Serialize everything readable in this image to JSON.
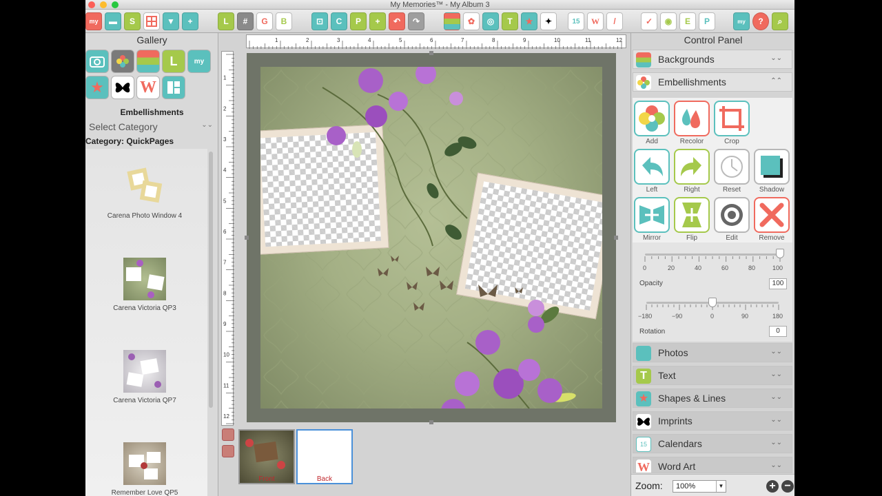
{
  "window": {
    "title": "My Memories™ - My Album 3"
  },
  "gallery": {
    "title": "Gallery",
    "section_label": "Embellishments",
    "select_category": "Select Category",
    "category_label": "Category: QuickPages",
    "items": [
      {
        "caption": "Carena Photo Window 4"
      },
      {
        "caption": "Carena Victoria QP3"
      },
      {
        "caption": "Carena Victoria QP7"
      },
      {
        "caption": "Remember Love QP5"
      }
    ]
  },
  "toolbar": {
    "icons": [
      "my-logo",
      "folder",
      "save",
      "layout",
      "shield",
      "add-page",
      "layout-L",
      "grid",
      "text-G",
      "text-B",
      "crop-box",
      "copy",
      "paste",
      "add",
      "undo",
      "redo",
      "background",
      "embellishment",
      "photo",
      "text",
      "shape",
      "imprint",
      "calendar",
      "word-art",
      "brush",
      "sign",
      "cd",
      "export",
      "publish",
      "my-com",
      "help",
      "search"
    ]
  },
  "canvas": {
    "ruler_h_labels": [
      "1",
      "2",
      "3",
      "4",
      "5",
      "6",
      "7",
      "8",
      "9",
      "10",
      "11",
      "12"
    ],
    "ruler_v_labels": [
      "1",
      "2",
      "3",
      "4",
      "5",
      "6",
      "7",
      "8",
      "9",
      "10",
      "11",
      "12"
    ],
    "pages": [
      {
        "label": "Front"
      },
      {
        "label": "Back"
      }
    ]
  },
  "control_panel": {
    "title": "Control Panel",
    "sections_top": [
      {
        "label": "Backgrounds",
        "icon": "backgrounds-icon"
      },
      {
        "label": "Embellishments",
        "icon": "embellishments-icon"
      }
    ],
    "tools": [
      {
        "label": "Add"
      },
      {
        "label": "Recolor"
      },
      {
        "label": "Crop"
      },
      {
        "label": "Left"
      },
      {
        "label": "Right"
      },
      {
        "label": "Reset"
      },
      {
        "label": "Shadow"
      },
      {
        "label": "Mirror"
      },
      {
        "label": "Flip"
      },
      {
        "label": "Edit"
      },
      {
        "label": "Remove"
      }
    ],
    "opacity": {
      "label": "Opacity",
      "value": "100",
      "ticks": [
        "0",
        "20",
        "40",
        "60",
        "80",
        "100"
      ],
      "level": 100
    },
    "rotation": {
      "label": "Rotation",
      "value": "0",
      "ticks": [
        "−180",
        "−90",
        "0",
        "90",
        "180"
      ],
      "level": 0
    },
    "sections_bottom": [
      {
        "label": "Photos"
      },
      {
        "label": "Text"
      },
      {
        "label": "Shapes & Lines"
      },
      {
        "label": "Imprints"
      },
      {
        "label": "Calendars"
      },
      {
        "label": "Word Art"
      }
    ],
    "zoom": {
      "label": "Zoom:",
      "value": "100%"
    }
  },
  "colors": {
    "accent_teal": "#5bc0bd",
    "accent_red": "#f06a5e",
    "accent_green": "#a5c94b",
    "accent_yellow": "#f2d649"
  }
}
